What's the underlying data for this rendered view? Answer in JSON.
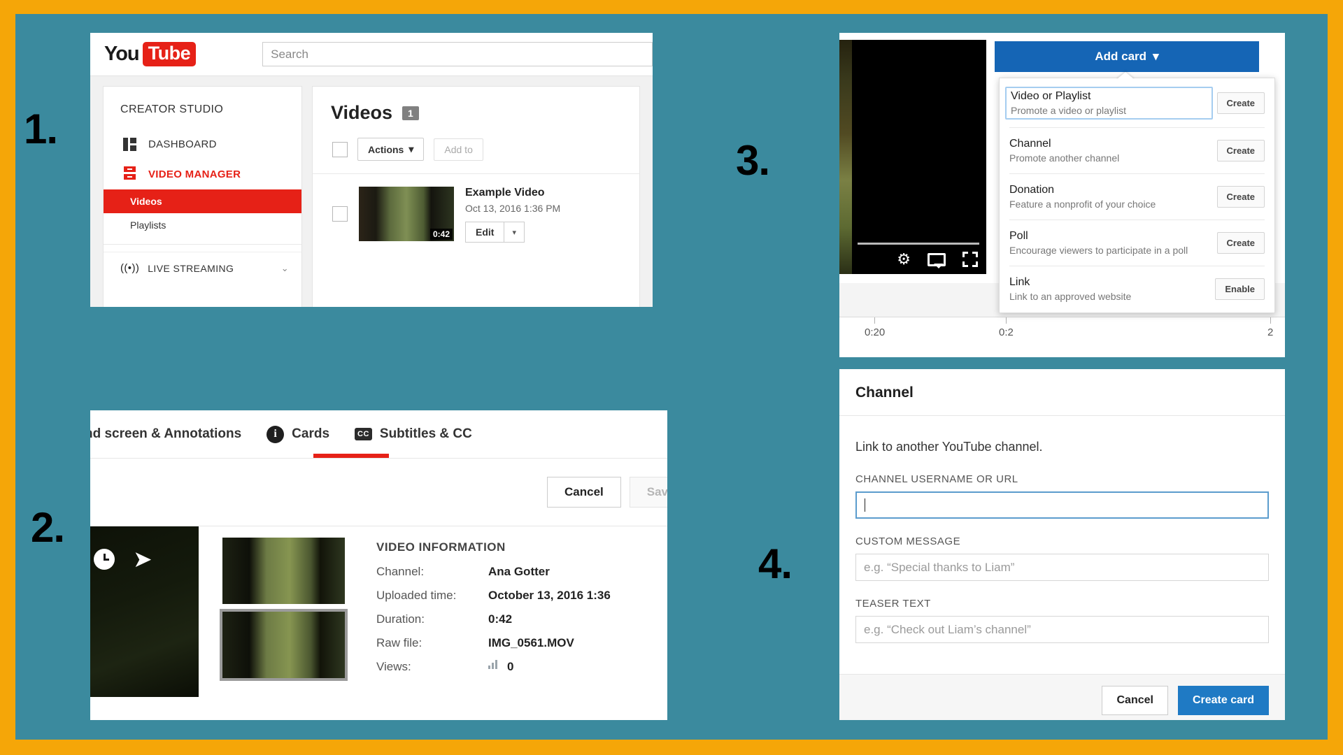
{
  "theme": {
    "border": "#F5A608",
    "background": "#3B8A9E",
    "youtube_red": "#E62117",
    "blue": "#1565B5"
  },
  "steps": {
    "one": "1.",
    "two": "2.",
    "three": "3.",
    "four": "4."
  },
  "panel1": {
    "logo_you": "You",
    "logo_tube": "Tube",
    "search_placeholder": "Search",
    "sidebar": {
      "heading": "CREATOR STUDIO",
      "items": [
        {
          "label": "DASHBOARD",
          "icon": "dashboard-icon"
        },
        {
          "label": "VIDEO MANAGER",
          "icon": "video-manager-icon"
        }
      ],
      "sub_items": [
        {
          "label": "Videos",
          "active": true
        },
        {
          "label": "Playlists",
          "active": false
        }
      ],
      "live": {
        "label": "LIVE STREAMING",
        "icon": "broadcast-icon",
        "chevron": "⌄"
      }
    },
    "main": {
      "title": "Videos",
      "count": "1",
      "actions_label": "Actions",
      "actions_caret": "▾",
      "add_to_label": "Add to",
      "video": {
        "title": "Example Video",
        "date": "Oct 13, 2016 1:36 PM",
        "duration": "0:42",
        "edit_label": "Edit",
        "edit_caret": "▾"
      }
    }
  },
  "panel2": {
    "tabs": [
      {
        "label": "nd screen & Annotations",
        "icon": null,
        "active": false
      },
      {
        "label": "Cards",
        "icon": "info-icon",
        "active": true
      },
      {
        "label": "Subtitles & CC",
        "icon": "cc-icon",
        "active": false
      }
    ],
    "cancel_label": "Cancel",
    "save_label": "Sav",
    "preview_icons": [
      "clock-icon",
      "share-icon"
    ],
    "video_information": {
      "heading": "VIDEO INFORMATION",
      "rows": [
        {
          "key": "Channel:",
          "value": "Ana Gotter"
        },
        {
          "key": "Uploaded time:",
          "value": "October 13, 2016 1:36"
        },
        {
          "key": "Duration:",
          "value": "0:42"
        },
        {
          "key": "Raw file:",
          "value": "IMG_0561.MOV"
        },
        {
          "key": "Views:",
          "value": "0",
          "icon": "bar-chart-icon"
        }
      ]
    }
  },
  "panel3": {
    "add_card_label": "Add card",
    "add_card_caret": "▾",
    "player_controls": [
      "settings-gear-icon",
      "cast-icon",
      "fullscreen-icon"
    ],
    "timeline_ticks": [
      "0:20",
      "0:2",
      "2"
    ],
    "menu": [
      {
        "title": "Video or Playlist",
        "desc": "Promote a video or playlist",
        "action": "Create",
        "focused": true
      },
      {
        "title": "Channel",
        "desc": "Promote another channel",
        "action": "Create",
        "focused": false
      },
      {
        "title": "Donation",
        "desc": "Feature a nonprofit of your choice",
        "action": "Create",
        "focused": false
      },
      {
        "title": "Poll",
        "desc": "Encourage viewers to participate in a poll",
        "action": "Create",
        "focused": false
      },
      {
        "title": "Link",
        "desc": "Link to an approved website",
        "action": "Enable",
        "focused": false
      }
    ]
  },
  "panel4": {
    "title": "Channel",
    "lead": "Link to another YouTube channel.",
    "fields": [
      {
        "label": "CHANNEL USERNAME OR URL",
        "value": "",
        "placeholder": "",
        "focused": true
      },
      {
        "label": "CUSTOM MESSAGE",
        "value": "",
        "placeholder": "e.g. “Special thanks to Liam”",
        "focused": false
      },
      {
        "label": "TEASER TEXT",
        "value": "",
        "placeholder": "e.g. “Check out Liam’s channel”",
        "focused": false
      }
    ],
    "cancel_label": "Cancel",
    "create_label": "Create card"
  }
}
